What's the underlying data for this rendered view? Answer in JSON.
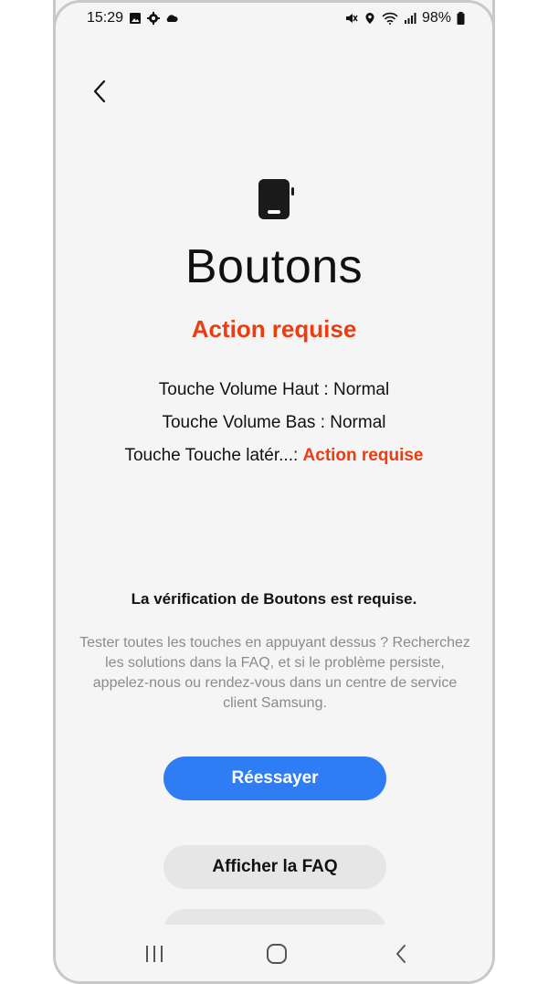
{
  "status_bar": {
    "time": "15:29",
    "battery": "98%",
    "left_icons": [
      "gallery-icon",
      "settings-icon",
      "cloud-icon"
    ],
    "right_icons": [
      "mute-icon",
      "location-icon",
      "wifi-icon",
      "signal-icon",
      "battery-icon"
    ]
  },
  "header": {
    "back_icon": "back-chevron-icon"
  },
  "main": {
    "device_icon": "phone-side-button-icon",
    "title": "Boutons",
    "status": "Action requise",
    "checks": [
      {
        "label": "Touche Volume Haut : ",
        "value": "Normal",
        "alert": false
      },
      {
        "label": "Touche Volume Bas : ",
        "value": "Normal",
        "alert": false
      },
      {
        "label": "Touche Touche latér...: ",
        "value": "Action requise",
        "alert": true
      }
    ],
    "requirement_title": "La vérification de Boutons est requise.",
    "requirement_desc": "Tester toutes les touches en appuyant dessus ? Recherchez les solutions dans la FAQ, et si le problème persiste, appelez-nous ou rendez-vous dans un centre de service client Samsung."
  },
  "buttons": {
    "retry": "Réessayer",
    "faq": "Afficher la FAQ",
    "third": ""
  },
  "colors": {
    "accent_blue": "#2f7df5",
    "alert_red": "#ea3d12",
    "background": "#f5f5f5"
  },
  "nav_bar": {
    "items": [
      "recent-apps-icon",
      "home-icon",
      "back-icon"
    ]
  }
}
